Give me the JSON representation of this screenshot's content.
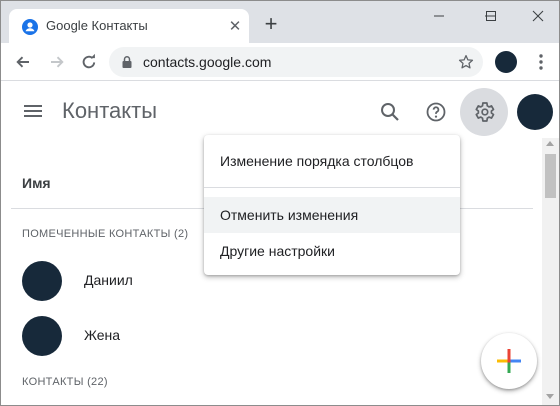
{
  "browser": {
    "tab_title": "Google Контакты",
    "tab_close_glyph": "✕",
    "new_tab_glyph": "+",
    "url": "contacts.google.com",
    "favicon": "contacts-person-icon",
    "accent": "#1a73e8"
  },
  "app": {
    "title": "Контакты",
    "header_icons": [
      "menu-icon",
      "search-icon",
      "help-icon",
      "settings-gear-icon",
      "account-avatar"
    ]
  },
  "list": {
    "column_header": "Имя",
    "starred_section": "ПОМЕЧЕННЫЕ КОНТАКТЫ (2)",
    "starred_contacts": [
      {
        "name": "Даниил"
      },
      {
        "name": "Жена"
      }
    ],
    "contacts_section": "КОНТАКТЫ (22)"
  },
  "settings_menu": {
    "items": [
      {
        "label": "Изменение порядка столбцов"
      },
      {
        "label": "Отменить изменения",
        "hovered": true
      },
      {
        "label": "Другие настройки"
      }
    ]
  },
  "fab": {
    "icon": "create-contact-plus-icon",
    "colors": [
      "#4285f4",
      "#ea4335",
      "#fbbc04",
      "#34a853"
    ]
  },
  "colors": {
    "avatar": "#17293a",
    "gear_active_bg": "#dadce0"
  }
}
